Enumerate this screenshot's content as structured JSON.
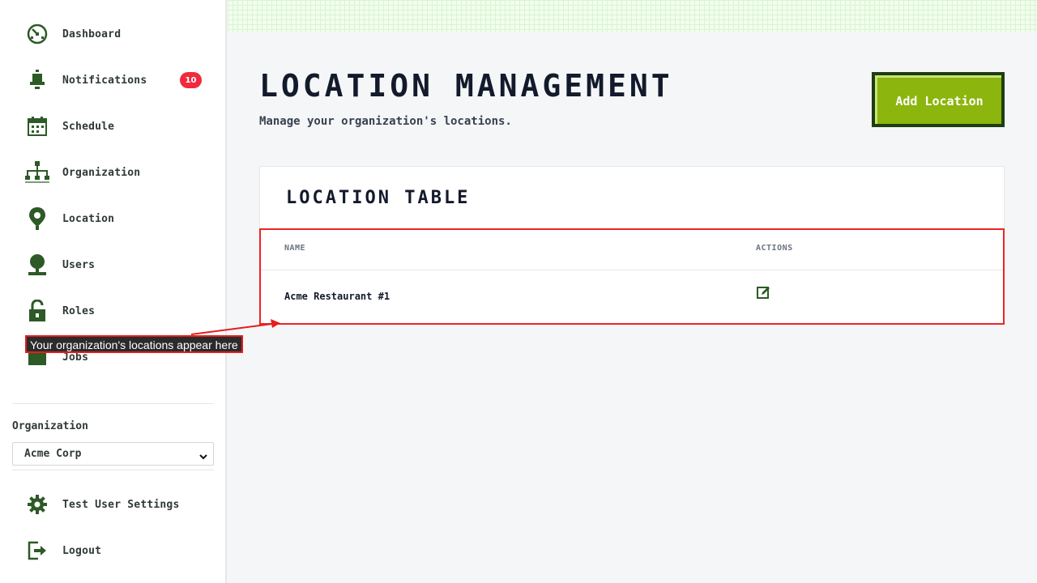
{
  "sidebar": {
    "items": [
      {
        "label": "Dashboard",
        "icon": "dashboard-icon"
      },
      {
        "label": "Notifications",
        "icon": "bell-icon",
        "badge": "10"
      },
      {
        "label": "Schedule",
        "icon": "calendar-icon"
      },
      {
        "label": "Organization",
        "icon": "org-chart-icon"
      },
      {
        "label": "Location",
        "icon": "location-pin-icon"
      },
      {
        "label": "Users",
        "icon": "user-icon"
      },
      {
        "label": "Roles",
        "icon": "lock-icon"
      },
      {
        "label": "Jobs",
        "icon": "briefcase-icon"
      }
    ],
    "org_label": "Organization",
    "org_selected": "Acme Corp",
    "bottom_items": [
      {
        "label": "Test User Settings",
        "icon": "gear-icon"
      },
      {
        "label": "Logout",
        "icon": "logout-icon"
      }
    ]
  },
  "header": {
    "title": "LOCATION MANAGEMENT",
    "subtitle": "Manage your organization's locations.",
    "add_button": "Add Location"
  },
  "table": {
    "title": "LOCATION TABLE",
    "columns": [
      "NAME",
      "ACTIONS"
    ],
    "rows": [
      {
        "name": "Acme Restaurant #1",
        "action_icon": "edit-icon"
      }
    ]
  },
  "annotation": {
    "text": "Your organization's locations appear here"
  },
  "colors": {
    "brand_green": "#2d5a27",
    "button_green": "#8cb50d",
    "badge_red": "#ef2b3d",
    "annotation_red": "#ee2424"
  }
}
